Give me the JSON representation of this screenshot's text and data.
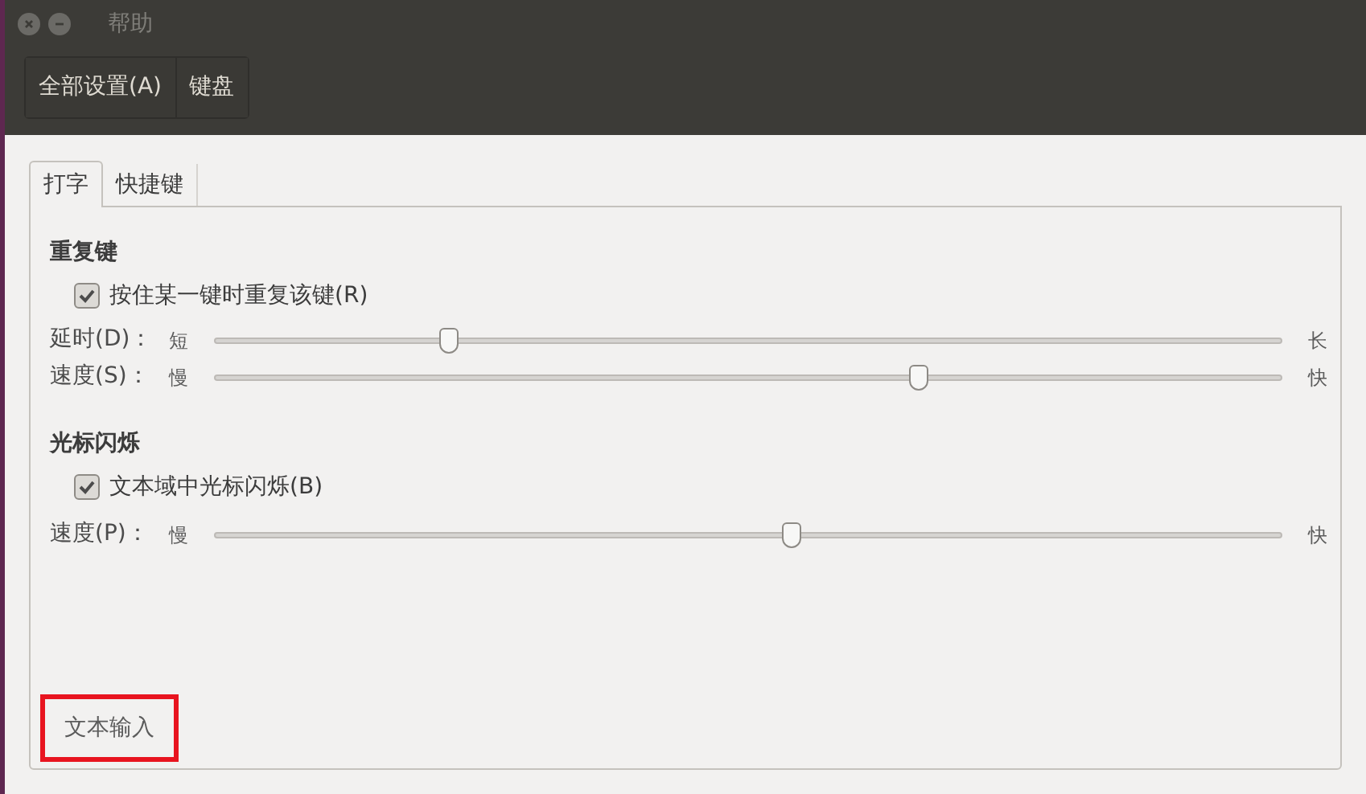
{
  "window": {
    "title": "帮助"
  },
  "toolbar": {
    "buttons": [
      {
        "label": "全部设置(A)"
      },
      {
        "label": "键盘"
      }
    ]
  },
  "tabs": [
    {
      "label": "打字",
      "selected": true
    },
    {
      "label": "快捷键",
      "selected": false
    }
  ],
  "sections": [
    {
      "title": "重复键",
      "checkbox": {
        "label": "按住某一键时重复该键(R)",
        "checked": true
      },
      "sliders": [
        {
          "label": "延时(D)：",
          "low": "短",
          "high": "长",
          "level": 0.22
        },
        {
          "label": "速度(S)：",
          "low": "慢",
          "high": "快",
          "level": 0.66
        }
      ]
    },
    {
      "title": "光标闪烁",
      "checkbox": {
        "label": "文本域中光标闪烁(B)",
        "checked": true
      },
      "sliders": [
        {
          "label": "速度(P)：",
          "low": "慢",
          "high": "快",
          "level": 0.54
        }
      ]
    }
  ],
  "bottom_button": {
    "label": "文本输入",
    "highlighted": true
  }
}
